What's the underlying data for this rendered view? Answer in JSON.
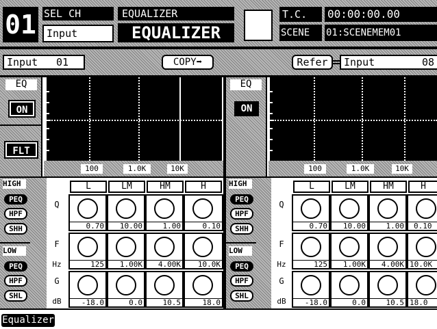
{
  "header": {
    "channel_number": "01",
    "sel_ch_label": "SEL CH",
    "sel_ch_value": "Input",
    "screen_label": "EQUALIZER",
    "screen_title": "EQUALIZER",
    "tc_label": "T.C.",
    "tc_value": "00:00:00.00",
    "scene_label": "SCENE",
    "scene_value": "01:SCENEMEM01"
  },
  "toolbar": {
    "input_label": "Input",
    "input_number": "01",
    "copy_label": "COPY➡",
    "refer_label": "Refer",
    "refer_input_label": "Input",
    "refer_input_number": "08"
  },
  "left_panel": {
    "eq_label": "EQ",
    "on_label": "ON",
    "flt_label": "FLT",
    "freq_ticks": [
      "100",
      "1.0K",
      "10K"
    ],
    "high_label": "HIGH",
    "low_label": "LOW",
    "high_buttons": [
      "PEQ",
      "HPF",
      "SHH"
    ],
    "low_buttons": [
      "PEQ",
      "HPF",
      "SHL"
    ],
    "bands": [
      "L",
      "LM",
      "HM",
      "H"
    ],
    "row_labels": {
      "q": "Q",
      "f": "F",
      "f_unit": "Hz",
      "g": "G",
      "g_unit": "dB"
    },
    "q_values": [
      "0.70",
      "10.00",
      "1.00",
      "0.10"
    ],
    "f_values": [
      "125",
      "1.00K",
      "4.00K",
      "10.0K"
    ],
    "g_values": [
      "-18.0",
      "0.0",
      "10.5",
      "18.0"
    ]
  },
  "right_panel": {
    "eq_label": "EQ",
    "on_label": "ON",
    "freq_ticks": [
      "100",
      "1.0K",
      "10K"
    ],
    "high_label": "HIGH",
    "low_label": "LOW",
    "high_buttons": [
      "PEQ",
      "HPF",
      "SHH"
    ],
    "low_buttons": [
      "PEQ",
      "HPF",
      "SHL"
    ],
    "bands": [
      "L",
      "LM",
      "HM",
      "H"
    ],
    "row_labels": {
      "q": "Q",
      "f": "F",
      "f_unit": "Hz",
      "g": "G",
      "g_unit": "dB"
    },
    "q_values": [
      "0.70",
      "10.00",
      "1.00",
      "0.10"
    ],
    "f_values": [
      "125",
      "1.00K",
      "4.00K",
      "10.0K"
    ],
    "g_values": [
      "-18.0",
      "0.0",
      "10.5",
      "18.0"
    ]
  },
  "footer": {
    "label": "Equalizer"
  },
  "colors": {
    "foreground": "#000000",
    "background": "#ffffff",
    "pattern": "#b8b8b8"
  }
}
